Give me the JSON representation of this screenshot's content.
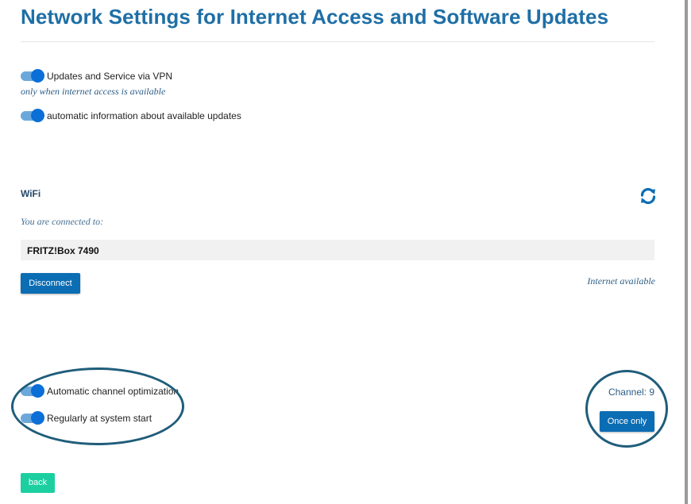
{
  "header": {
    "title": "Network Settings for Internet Access and Software Updates"
  },
  "updates": {
    "vpn_toggle": {
      "label": "Updates and Service via VPN",
      "on": true
    },
    "vpn_note": "only when internet access is available",
    "info_toggle": {
      "label": "automatic information about available updates",
      "on": true
    }
  },
  "wifi": {
    "title": "WiFi",
    "refresh_icon": "refresh-icon",
    "connected_label": "You are connected to:",
    "network_name": "FRITZ!Box 7490",
    "disconnect_label": "Disconnect",
    "status": "Internet available"
  },
  "channel": {
    "auto_toggle": {
      "label": "Automatic channel optimization",
      "on": true
    },
    "start_toggle": {
      "label": "Regularly at system start",
      "on": true
    },
    "channel_text": "Channel: 9",
    "once_label": "Once only"
  },
  "footer": {
    "back_label": "back"
  },
  "colors": {
    "title": "#1f6fa6",
    "primary_button": "#0b6db3",
    "back_button": "#1ccfa0",
    "toggle_knob": "#0a6fd6",
    "toggle_track": "#6aa8dc",
    "annotation": "#1f5d7a"
  }
}
